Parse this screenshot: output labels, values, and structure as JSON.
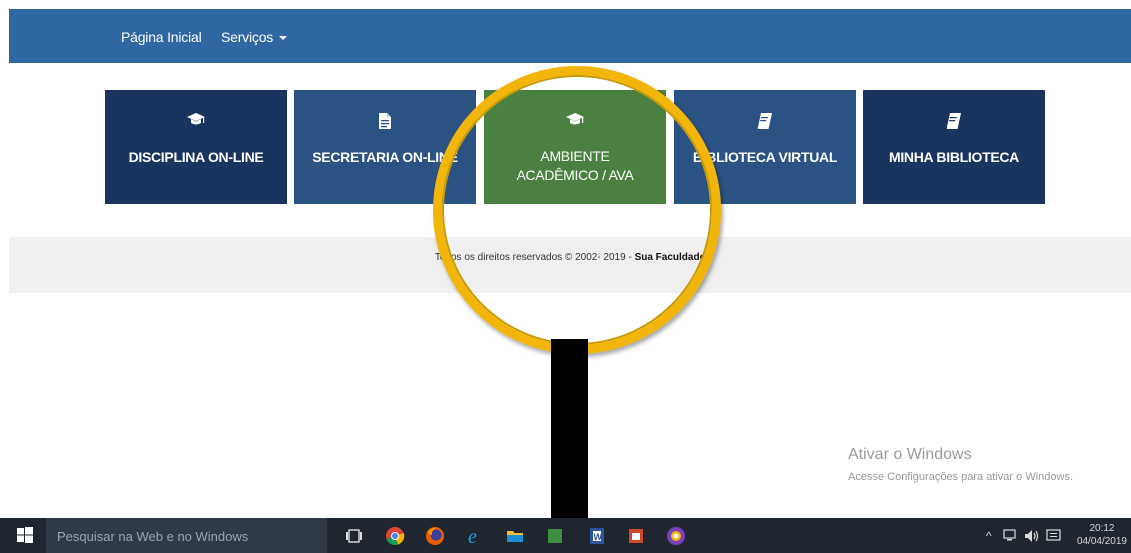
{
  "navbar": {
    "home_label": "Página Inicial",
    "services_label": "Serviços",
    "bg_color": "#2e67a1"
  },
  "tiles": [
    {
      "label": "DISCIPLINA ON-LINE",
      "icon": "graduation-cap-icon"
    },
    {
      "label": "SECRETARIA ON-LINE",
      "icon": "document-icon"
    },
    {
      "label_line1": "AMBIENTE",
      "label_line2": "ACADÊMICO / AVA",
      "icon": "graduation-cap-icon",
      "color": "#4a8140"
    },
    {
      "label": "BIBLIOTECA VIRTUAL",
      "icon": "book-icon"
    },
    {
      "label": "MINHA BIBLIOTECA",
      "icon": "book-icon"
    }
  ],
  "footer": {
    "text": "Todos os direitos reservados © 2002- 2019 - ",
    "brand": "Sua Faculdade"
  },
  "watermark": {
    "title": "Ativar o Windows",
    "subtitle": "Acesse Configurações para ativar o Windows."
  },
  "taskbar": {
    "search_placeholder": "Pesquisar na Web e no Windows",
    "time": "20:12",
    "date": "04/04/2019"
  },
  "colors": {
    "tile_dark": "#19355f",
    "tile_mid": "#2a5283",
    "tile_green": "#4a8140",
    "lens": "#f2b50a"
  }
}
